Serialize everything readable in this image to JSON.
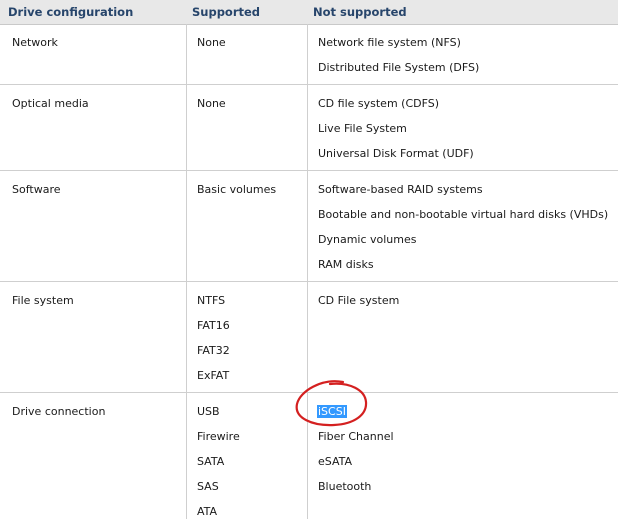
{
  "table": {
    "headers": [
      "Drive configuration",
      "Supported",
      "Not supported"
    ],
    "rows": [
      {
        "config": "Network",
        "supported": [
          "None"
        ],
        "not_supported": [
          "Network file system (NFS)",
          "Distributed File System (DFS)"
        ]
      },
      {
        "config": "Optical media",
        "supported": [
          "None"
        ],
        "not_supported": [
          "CD file system (CDFS)",
          "Live File System",
          "Universal Disk Format (UDF)"
        ]
      },
      {
        "config": "Software",
        "supported": [
          "Basic volumes"
        ],
        "not_supported": [
          "Software-based RAID systems",
          "Bootable and non-bootable virtual hard disks (VHDs)",
          "Dynamic volumes",
          "RAM disks"
        ]
      },
      {
        "config": "File system",
        "supported": [
          "NTFS",
          "FAT16",
          "FAT32",
          "ExFAT"
        ],
        "not_supported": [
          "CD File system"
        ]
      },
      {
        "config": "Drive connection",
        "supported": [
          "USB",
          "Firewire",
          "SATA",
          "SAS",
          "ATA"
        ],
        "not_supported": [
          "iSCSI",
          "Fiber Channel",
          "eSATA",
          "Bluetooth"
        ]
      }
    ]
  },
  "highlight": {
    "text": "iSCSI",
    "selection_color": "#3399ff",
    "annotation_color": "#d42020"
  }
}
